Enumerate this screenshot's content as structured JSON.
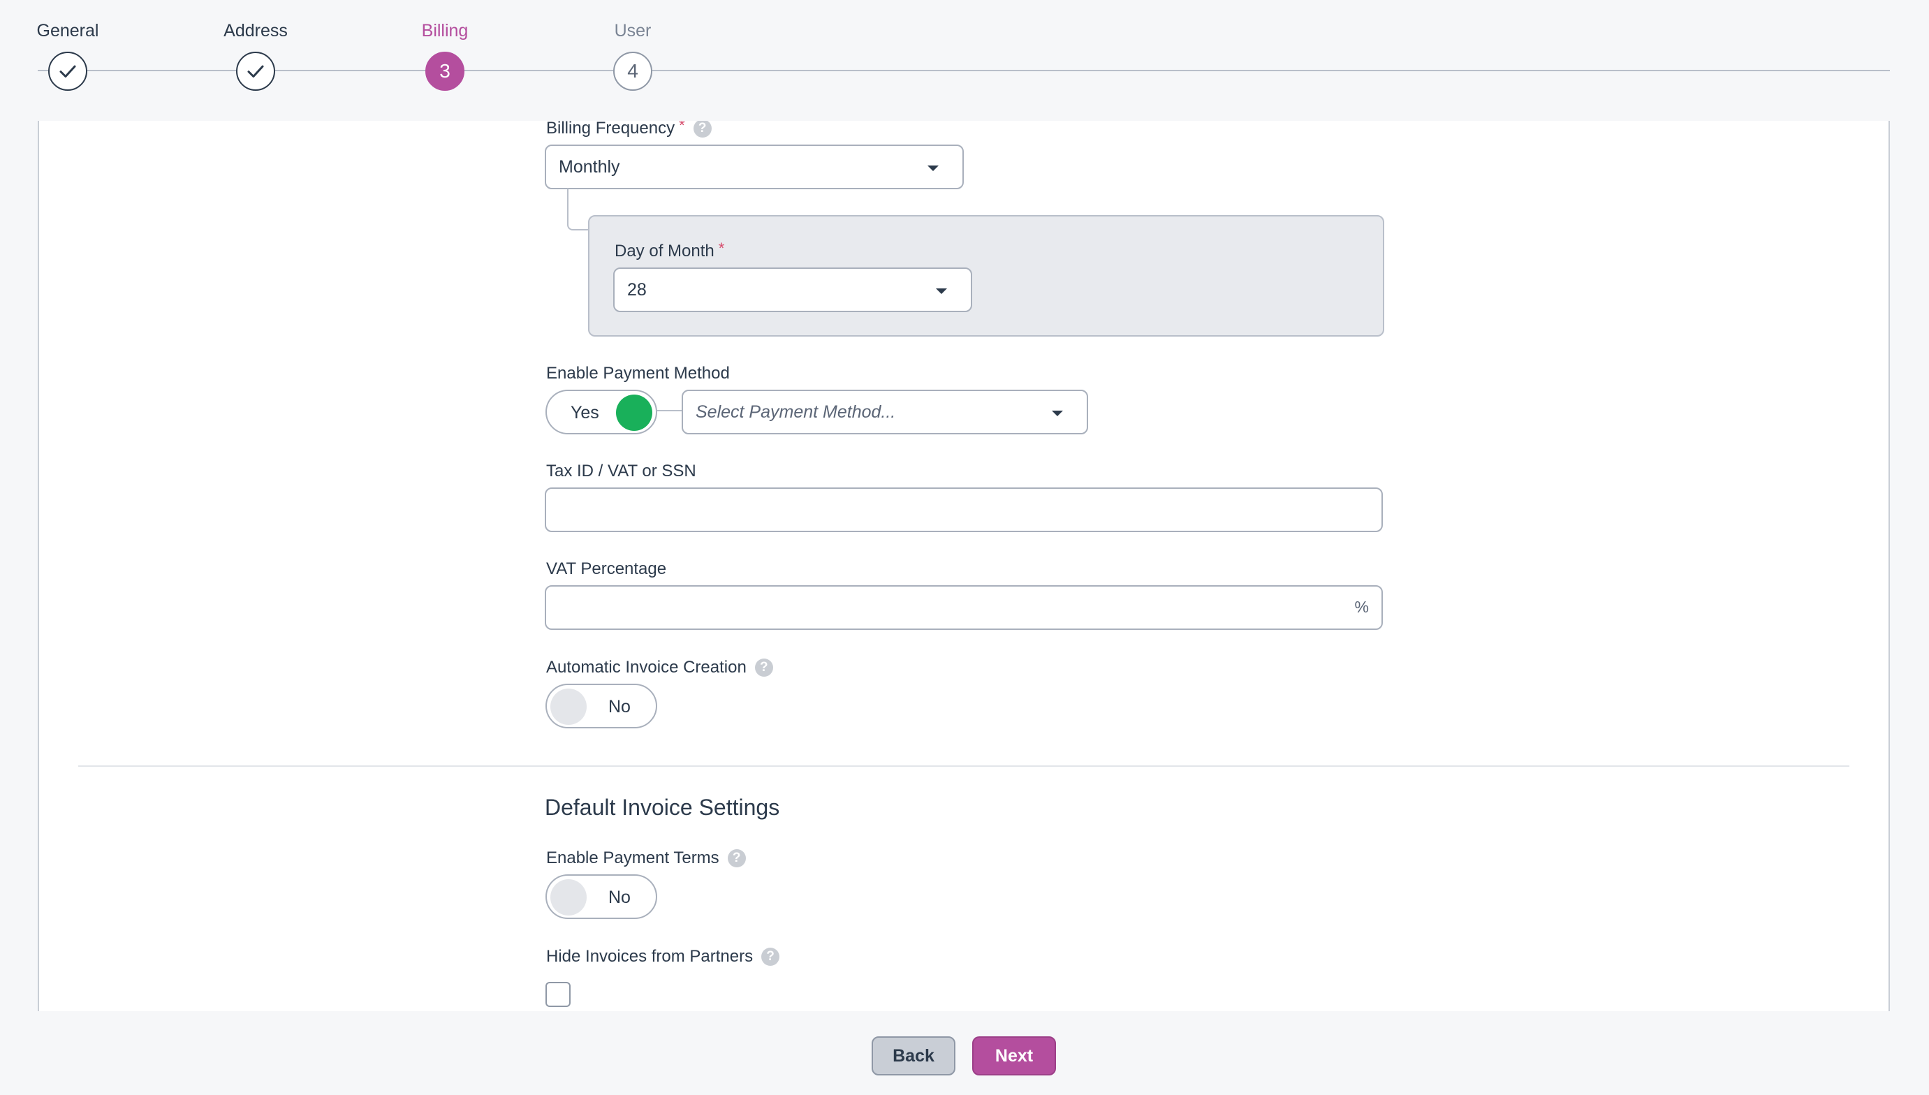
{
  "stepper": {
    "steps": [
      {
        "label": "General",
        "state": "complete"
      },
      {
        "label": "Address",
        "state": "complete"
      },
      {
        "label": "Billing",
        "state": "active",
        "number": "3"
      },
      {
        "label": "User",
        "state": "future",
        "number": "4"
      }
    ],
    "accent_color": "#b44e9e"
  },
  "billing": {
    "frequency": {
      "label": "Billing Frequency",
      "required": "*",
      "value": "Monthly"
    },
    "day_of_month": {
      "label": "Day of Month",
      "required": "*",
      "value": "28"
    },
    "payment_method": {
      "label": "Enable Payment Method",
      "toggle_label": "Yes",
      "toggle_on": true,
      "select_placeholder": "Select Payment Method..."
    },
    "tax_id": {
      "label": "Tax ID / VAT or SSN",
      "value": ""
    },
    "vat_percentage": {
      "label": "VAT Percentage",
      "value": "",
      "suffix": "%"
    },
    "auto_invoice": {
      "label": "Automatic Invoice Creation",
      "toggle_label": "No",
      "toggle_on": false
    }
  },
  "invoice_settings": {
    "title": "Default Invoice Settings",
    "payment_terms": {
      "label": "Enable Payment Terms",
      "toggle_label": "No",
      "toggle_on": false
    },
    "hide_invoices": {
      "label": "Hide Invoices from Partners",
      "checked": false
    }
  },
  "footer": {
    "back_label": "Back",
    "next_label": "Next"
  },
  "icons": {
    "check": "check-icon",
    "help": "help-icon",
    "caret": "chevron-down-icon"
  }
}
